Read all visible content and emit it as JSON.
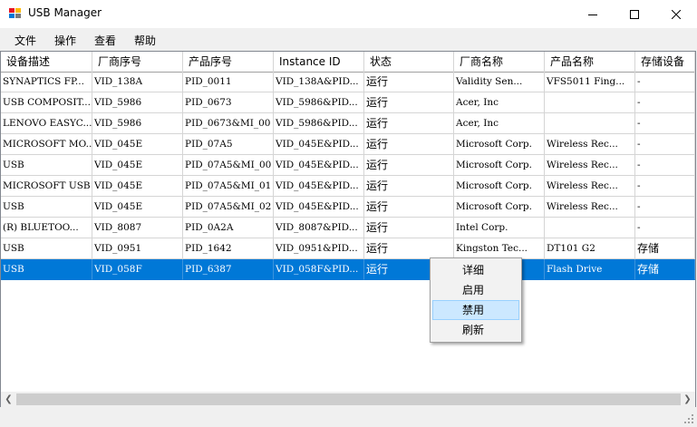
{
  "window": {
    "title": "USB Manager",
    "controls": [
      "minimize",
      "maximize",
      "close"
    ]
  },
  "menu": [
    "文件",
    "操作",
    "查看",
    "帮助"
  ],
  "columns": [
    "设备描述",
    "厂商序号",
    "产品序号",
    "Instance ID",
    "状态",
    "厂商名称",
    "产品名称",
    "存储设备"
  ],
  "rows": [
    [
      "SYNAPTICS FP...",
      "VID_138A",
      "PID_0011",
      "VID_138A&PID...",
      "运行",
      "Validity Sen...",
      "VFS5011 Fing...",
      "-"
    ],
    [
      "USB COMPOSIT...",
      "VID_5986",
      "PID_0673",
      "VID_5986&PID...",
      "运行",
      "Acer, Inc",
      "",
      "-"
    ],
    [
      "LENOVO EASYC...",
      "VID_5986",
      "PID_0673&MI_00",
      "VID_5986&PID...",
      "运行",
      "Acer, Inc",
      "",
      "-"
    ],
    [
      "MICROSOFT MO...",
      "VID_045E",
      "PID_07A5",
      "VID_045E&PID...",
      "运行",
      "Microsoft Corp.",
      "Wireless Rec...",
      "-"
    ],
    [
      "USB",
      "VID_045E",
      "PID_07A5&MI_00",
      "VID_045E&PID...",
      "运行",
      "Microsoft Corp.",
      "Wireless Rec...",
      "-"
    ],
    [
      "MICROSOFT  USB",
      "VID_045E",
      "PID_07A5&MI_01",
      "VID_045E&PID...",
      "运行",
      "Microsoft Corp.",
      "Wireless Rec...",
      "-"
    ],
    [
      "USB",
      "VID_045E",
      "PID_07A5&MI_02",
      "VID_045E&PID...",
      "运行",
      "Microsoft Corp.",
      "Wireless Rec...",
      "-"
    ],
    [
      "(R)  BLUETOO...",
      "VID_8087",
      "PID_0A2A",
      "VID_8087&PID...",
      "运行",
      "Intel Corp.",
      "",
      "-"
    ],
    [
      "USB",
      "VID_0951",
      "PID_1642",
      "VID_0951&PID...",
      "运行",
      "Kingston Tec...",
      "DT101 G2",
      "存储"
    ],
    [
      "USB",
      "VID_058F",
      "PID_6387",
      "VID_058F&PID...",
      "运行",
      "...",
      "Flash Drive",
      "存储"
    ]
  ],
  "selected_row": 9,
  "context_menu": {
    "items": [
      "详细",
      "启用",
      "禁用",
      "刷新"
    ],
    "highlighted": 2
  }
}
